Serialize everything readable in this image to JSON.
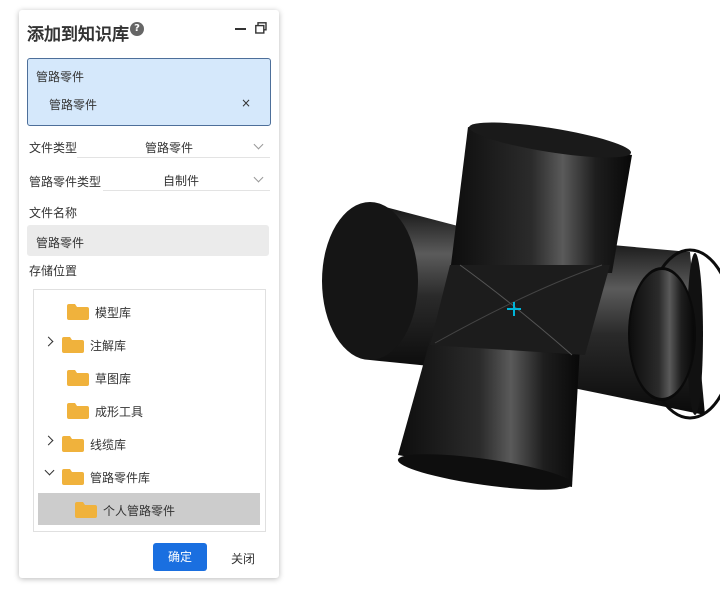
{
  "dialog": {
    "title": "添加到知识库",
    "help_glyph": "?",
    "selected_group": {
      "title": "管路零件",
      "item": "管路零件",
      "remove_glyph": "×"
    },
    "file_type": {
      "label": "文件类型",
      "value": "管路零件"
    },
    "part_type": {
      "label": "管路零件类型",
      "value": "自制件"
    },
    "file_name": {
      "label": "文件名称",
      "value": "管路零件"
    },
    "storage": {
      "label": "存储位置",
      "tree": [
        {
          "label": "模型库",
          "expander": "none"
        },
        {
          "label": "注解库",
          "expander": "collapsed"
        },
        {
          "label": "草图库",
          "expander": "none"
        },
        {
          "label": "成形工具",
          "expander": "none"
        },
        {
          "label": "线缆库",
          "expander": "collapsed"
        },
        {
          "label": "管路零件库",
          "expander": "expanded"
        },
        {
          "label": "个人管路零件",
          "expander": "none",
          "selected": true
        }
      ]
    },
    "ok_label": "确定",
    "close_label": "关闭"
  },
  "colors": {
    "accent": "#1a6fe0",
    "selection_fill": "#d5e8fb",
    "folder": "#f0b23c",
    "cursor": "#00b4d8"
  },
  "icons": [
    "help-icon",
    "minimize-icon",
    "restore-icon",
    "folder-icon",
    "chevron-down-icon",
    "chevron-right-icon",
    "crosshair-icon"
  ]
}
